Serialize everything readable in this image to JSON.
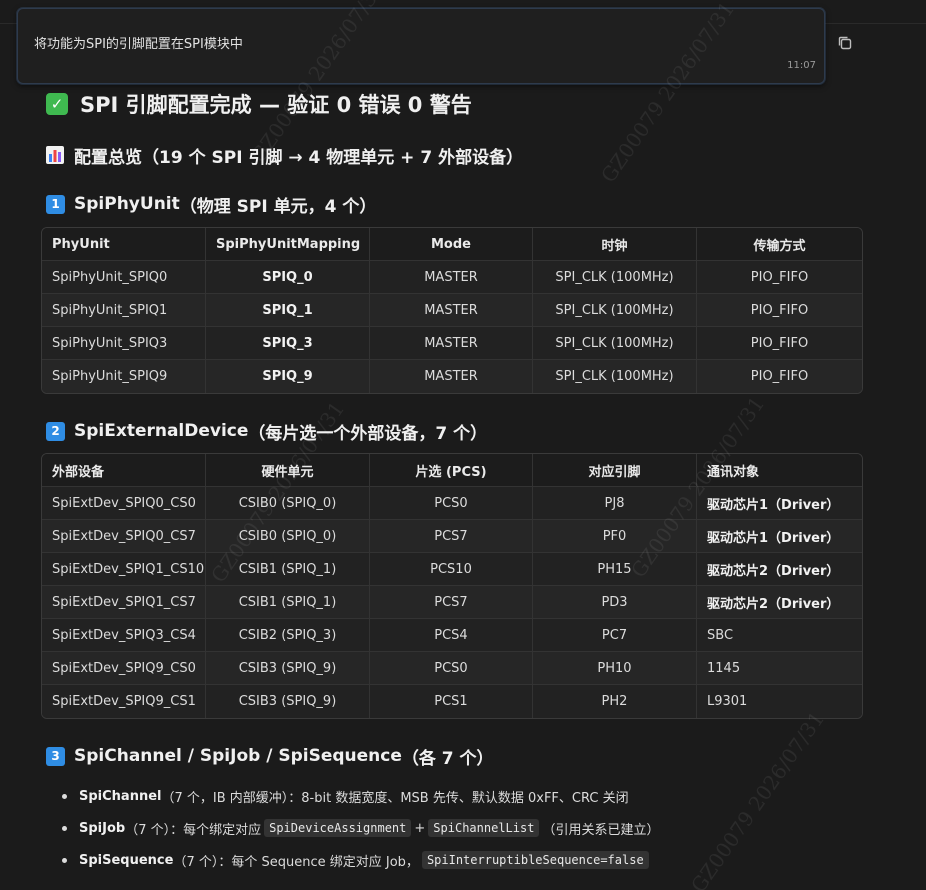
{
  "user_message": {
    "text": "将功能为SPI的引脚配置在SPI模块中",
    "time": "11:07"
  },
  "title": "SPI 引脚配置完成 — 验证 0 错误 0 警告",
  "overview": {
    "label": "配置总览",
    "detail": "（19 个 SPI 引脚 → 4 物理单元 + 7 外部设备）"
  },
  "section1": {
    "num": "1",
    "name": "SpiPhyUnit",
    "detail": "（物理 SPI 单元，4 个）",
    "headers": [
      "PhyUnit",
      "SpiPhyUnitMapping",
      "Mode",
      "时钟",
      "传输方式"
    ],
    "rows": [
      [
        "SpiPhyUnit_SPIQ0",
        "SPIQ_0",
        "MASTER",
        "SPI_CLK (100MHz)",
        "PIO_FIFO"
      ],
      [
        "SpiPhyUnit_SPIQ1",
        "SPIQ_1",
        "MASTER",
        "SPI_CLK (100MHz)",
        "PIO_FIFO"
      ],
      [
        "SpiPhyUnit_SPIQ3",
        "SPIQ_3",
        "MASTER",
        "SPI_CLK (100MHz)",
        "PIO_FIFO"
      ],
      [
        "SpiPhyUnit_SPIQ9",
        "SPIQ_9",
        "MASTER",
        "SPI_CLK (100MHz)",
        "PIO_FIFO"
      ]
    ]
  },
  "section2": {
    "num": "2",
    "name": "SpiExternalDevice",
    "detail": "（每片选一个外部设备，7 个）",
    "headers": [
      "外部设备",
      "硬件单元",
      "片选 (PCS)",
      "对应引脚",
      "通讯对象"
    ],
    "rows": [
      [
        "SpiExtDev_SPIQ0_CS0",
        "CSIB0 (SPIQ_0)",
        "PCS0",
        "PJ8",
        "驱动芯片1（Driver）"
      ],
      [
        "SpiExtDev_SPIQ0_CS7",
        "CSIB0 (SPIQ_0)",
        "PCS7",
        "PF0",
        "驱动芯片1（Driver）"
      ],
      [
        "SpiExtDev_SPIQ1_CS10",
        "CSIB1 (SPIQ_1)",
        "PCS10",
        "PH15",
        "驱动芯片2（Driver）"
      ],
      [
        "SpiExtDev_SPIQ1_CS7",
        "CSIB1 (SPIQ_1)",
        "PCS7",
        "PD3",
        "驱动芯片2（Driver）"
      ],
      [
        "SpiExtDev_SPIQ3_CS4",
        "CSIB2 (SPIQ_3)",
        "PCS4",
        "PC7",
        "SBC"
      ],
      [
        "SpiExtDev_SPIQ9_CS0",
        "CSIB3 (SPIQ_9)",
        "PCS0",
        "PH10",
        "1145"
      ],
      [
        "SpiExtDev_SPIQ9_CS1",
        "CSIB3 (SPIQ_9)",
        "PCS1",
        "PH2",
        "L9301"
      ]
    ]
  },
  "section3": {
    "num": "3",
    "name": "SpiChannel / SpiJob / SpiSequence",
    "detail": "（各 7 个）",
    "bullets": [
      {
        "label": "SpiChannel",
        "text": "（7 个，IB 内部缓冲）：8-bit 数据宽度、MSB 先传、默认数据 0xFF、CRC 关闭"
      },
      {
        "label": "SpiJob",
        "text": "（7 个）：每个绑定对应",
        "code1": "SpiDeviceAssignment",
        "mid": "+",
        "code2": "SpiChannelList",
        "tail": "（引用关系已建立）"
      },
      {
        "label": "SpiSequence",
        "text": "（7 个）：每个 Sequence 绑定对应 Job，",
        "code1": "SpiInterruptibleSequence=false"
      }
    ]
  },
  "watermark": "GZ00079 2026/07/31",
  "colors": {
    "success": "#3fb950",
    "badge": "#2f8de4",
    "background": "#1b1b1b"
  }
}
